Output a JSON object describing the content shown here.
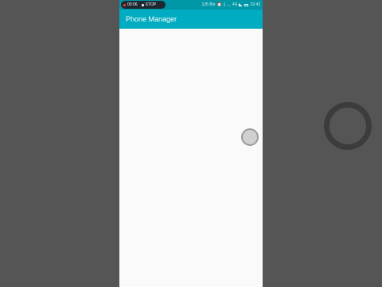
{
  "status_bar": {
    "recording_time": "00:06",
    "stop_label": "STOP",
    "network_speed": "125 B/s",
    "signal_text": "4G",
    "clock": "22:42"
  },
  "app_bar": {
    "title": "Phone Manager"
  },
  "colors": {
    "app_bar": "#00acc1",
    "status_bar": "#0097a7",
    "background": "#555555",
    "content": "#fafafa"
  }
}
